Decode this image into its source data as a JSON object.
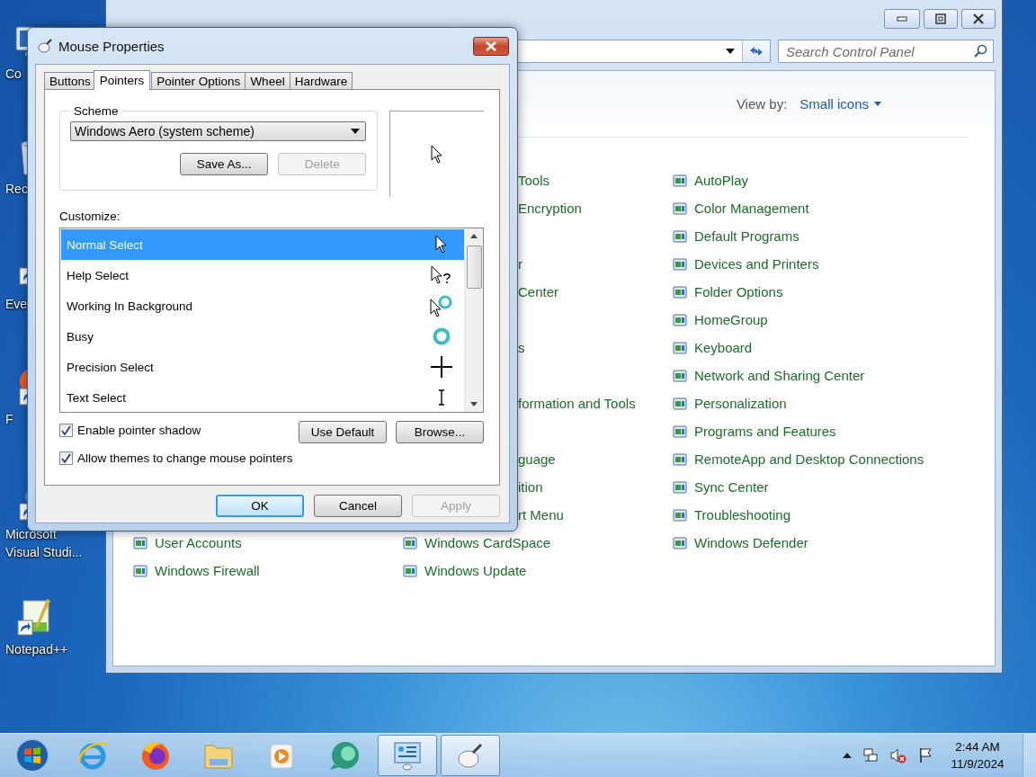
{
  "desktop_icons": [
    {
      "label": "Co",
      "kind": "computer"
    },
    {
      "label": "Rec",
      "kind": "recycle-bin"
    },
    {
      "label": "Eve",
      "kind": "shortcut"
    },
    {
      "label": "F",
      "kind": "firefox"
    },
    {
      "label": "Microsoft Visual Studi...",
      "kind": "studio"
    },
    {
      "label": "Notepad++",
      "kind": "notepad"
    }
  ],
  "control_panel": {
    "search": {
      "placeholder": "Search Control Panel"
    },
    "view_by": {
      "label": "View by:",
      "value": "Small icons"
    },
    "rows": [
      {
        "column_2": {
          "label": "Tools",
          "kind": "partial"
        },
        "column_3": {
          "label": "AutoPlay",
          "kind": "full"
        }
      },
      {
        "column_2": {
          "label": "Encryption",
          "kind": "partial"
        },
        "column_3": {
          "label": "Color Management",
          "kind": "full"
        }
      },
      {
        "column_3": {
          "label": "Default Programs",
          "kind": "full"
        }
      },
      {
        "column_2": {
          "label": "r",
          "kind": "partial"
        },
        "column_3": {
          "label": "Devices and Printers",
          "kind": "full"
        }
      },
      {
        "column_2": {
          "label": "Center",
          "kind": "partial"
        },
        "column_3": {
          "label": "Folder Options",
          "kind": "full"
        }
      },
      {
        "column_3": {
          "label": "HomeGroup",
          "kind": "full"
        }
      },
      {
        "column_2": {
          "label": "s",
          "kind": "partial"
        },
        "column_3": {
          "label": "Keyboard",
          "kind": "full"
        }
      },
      {
        "column_3": {
          "label": "Network and Sharing Center",
          "kind": "full"
        }
      },
      {
        "column_2": {
          "label": "formation and Tools",
          "kind": "partial"
        },
        "column_3": {
          "label": "Personalization",
          "kind": "full"
        }
      },
      {
        "column_3": {
          "label": "Programs and Features",
          "kind": "full"
        }
      },
      {
        "column_2": {
          "label": "guage",
          "kind": "partial"
        },
        "column_3": {
          "label": "RemoteApp and Desktop Connections",
          "kind": "full"
        }
      },
      {
        "column_2": {
          "label": "ition",
          "kind": "partial"
        },
        "column_3": {
          "label": "Sync Center",
          "kind": "full"
        }
      },
      {
        "column_2": {
          "label": "rt Menu",
          "kind": "partial"
        },
        "column_3": {
          "label": "Troubleshooting",
          "kind": "full"
        }
      },
      {
        "column_1": {
          "label": "User Accounts",
          "kind": "full"
        },
        "column_2": {
          "label": "Windows CardSpace",
          "kind": "full"
        },
        "column_3": {
          "label": "Windows Defender",
          "kind": "full"
        }
      },
      {
        "column_1": {
          "label": "Windows Firewall",
          "kind": "full"
        },
        "column_2": {
          "label": "Windows Update",
          "kind": "full"
        }
      }
    ]
  },
  "dialog": {
    "title": "Mouse Properties",
    "tabs": [
      {
        "label": "Buttons",
        "selected": false
      },
      {
        "label": "Pointers",
        "selected": true
      },
      {
        "label": "Pointer Options",
        "selected": false
      },
      {
        "label": "Wheel",
        "selected": false
      },
      {
        "label": "Hardware",
        "selected": false
      }
    ],
    "scheme": {
      "legend": "Scheme",
      "value": "Windows Aero (system scheme)",
      "buttons": [
        {
          "label": "Save As...",
          "disabled": false
        },
        {
          "label": "Delete",
          "disabled": true
        }
      ]
    },
    "customize": {
      "label": "Customize:",
      "items": [
        {
          "label": "Normal Select",
          "selected": true,
          "kind": "arrow"
        },
        {
          "label": "Help Select",
          "selected": false,
          "kind": "help"
        },
        {
          "label": "Working In Background",
          "selected": false,
          "kind": "working"
        },
        {
          "label": "Busy",
          "selected": false,
          "kind": "busy"
        },
        {
          "label": "Precision Select",
          "selected": false,
          "kind": "cross"
        },
        {
          "label": "Text Select",
          "selected": false,
          "kind": "text"
        }
      ]
    },
    "list_buttons": [
      {
        "label": "Use Default"
      },
      {
        "label": "Browse..."
      }
    ],
    "checkboxes": [
      {
        "label": "Enable pointer shadow",
        "checked": true
      },
      {
        "label": "Allow themes to change mouse pointers",
        "checked": true
      }
    ],
    "buttons": [
      {
        "label": "OK",
        "default": true,
        "disabled": false
      },
      {
        "label": "Cancel",
        "default": false,
        "disabled": false
      },
      {
        "label": "Apply",
        "default": false,
        "disabled": true
      }
    ]
  },
  "taskbar": {
    "items": [
      {
        "kind": "browser-e",
        "open": false
      },
      {
        "kind": "firefox",
        "open": false
      },
      {
        "kind": "folder",
        "open": false
      },
      {
        "kind": "player",
        "open": false
      },
      {
        "kind": "chat",
        "open": false
      },
      {
        "kind": "control-panel",
        "open": true
      },
      {
        "kind": "mouse",
        "open": true
      }
    ],
    "clock": {
      "time": "2:44 AM",
      "date": "11/9/2024"
    }
  }
}
